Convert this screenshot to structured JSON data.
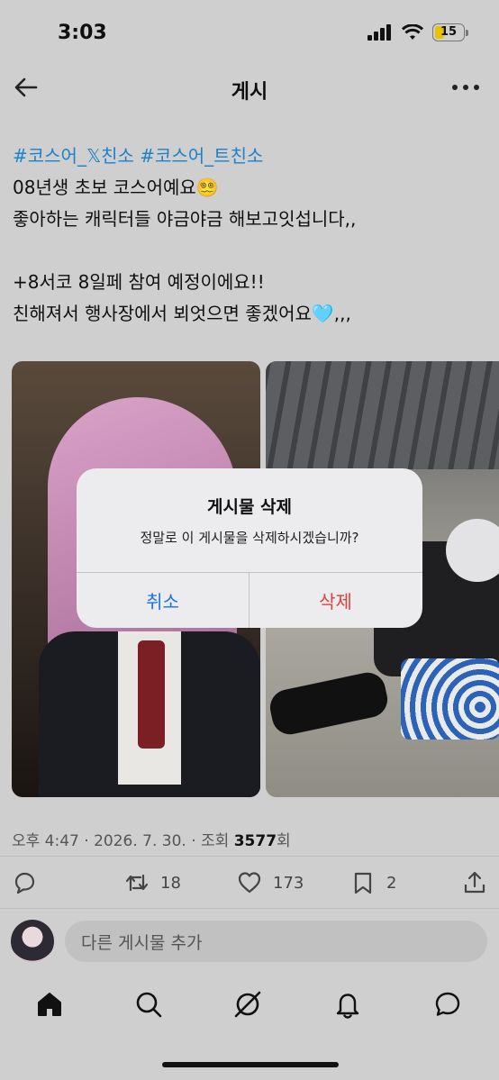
{
  "status_bar": {
    "time": "3:03",
    "battery": "15",
    "battery_color": "#e7c200"
  },
  "header": {
    "title": "게시",
    "back_icon": "arrow-left-icon",
    "more_icon": "more-horizontal-icon"
  },
  "post": {
    "hashtags": "#코스어_𝕏친소 #코스어_트친소",
    "lines": [
      "08년생 초보 코스어예요😵‍💫",
      "좋아하는 캐릭터들 야금야금 해보고잇섭니다,,",
      "",
      "+8서코 8일페 참여 예정이에요!!",
      "친해져서 행사장에서 뵈엇으면 좋겠어요🩵,,,"
    ],
    "hashtag_color": "#1d82c8"
  },
  "dialog": {
    "title": "게시물 삭제",
    "message": "정말로 이 게시물을 삭제하시겠습니까?",
    "cancel_label": "취소",
    "delete_label": "삭제",
    "cancel_color": "#1a73e0",
    "delete_color": "#e2403a"
  },
  "meta": {
    "prefix": "오후 4:47 · 2026. 7. 30. · 조회 ",
    "views": "3577",
    "suffix": "회"
  },
  "actions": {
    "reply_icon": "reply-icon",
    "retweet_count": "18",
    "like_count": "173",
    "bookmark_count": "2",
    "share_icon": "share-icon"
  },
  "reply": {
    "placeholder": "다른 게시물 추가"
  },
  "tabbar": {
    "items": [
      "home-icon",
      "search-icon",
      "grok-icon",
      "notifications-icon",
      "messages-icon"
    ]
  }
}
